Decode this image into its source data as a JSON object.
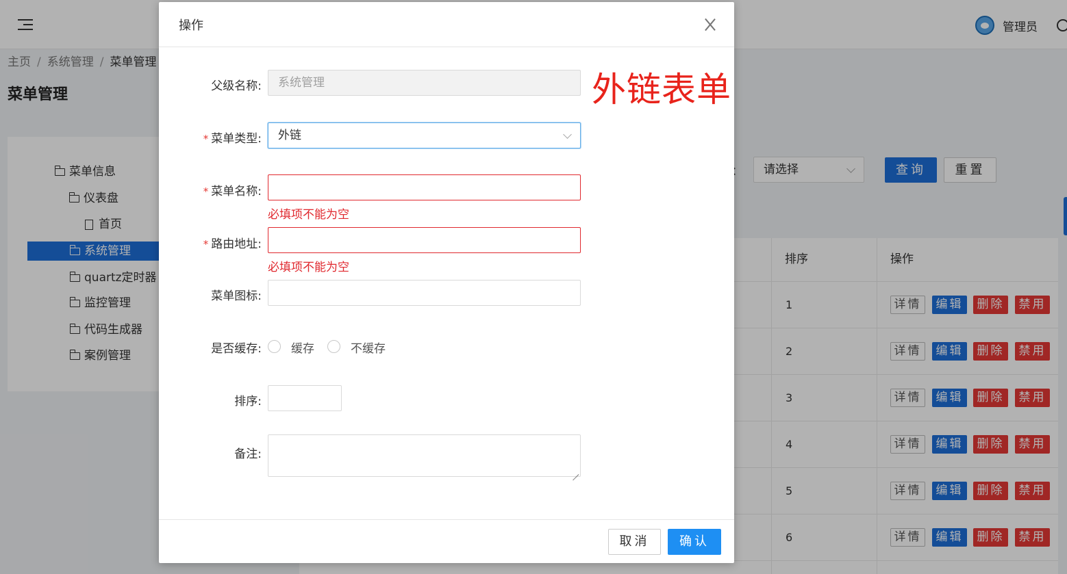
{
  "header": {
    "user_name": "管理员"
  },
  "breadcrumb": {
    "items": [
      "主页",
      "系统管理",
      "菜单管理"
    ]
  },
  "page": {
    "title": "菜单管理"
  },
  "tree": {
    "items": [
      {
        "label": "菜单信息"
      },
      {
        "label": "仪表盘"
      },
      {
        "label": "首页"
      },
      {
        "label": "系统管理"
      },
      {
        "label": "quartz定时器"
      },
      {
        "label": "监控管理"
      },
      {
        "label": "代码生成器"
      },
      {
        "label": "案例管理"
      }
    ]
  },
  "filter": {
    "label_suffix": "：",
    "select_value": "请选择",
    "query_button": "查询",
    "reset_button": "重置"
  },
  "table": {
    "columns": [
      "排序",
      "操作"
    ],
    "rows": [
      {
        "sort": "1"
      },
      {
        "sort": "2"
      },
      {
        "sort": "3"
      },
      {
        "sort": "4"
      },
      {
        "sort": "5"
      },
      {
        "sort": "6"
      }
    ],
    "actions": {
      "detail": "详情",
      "edit": "编辑",
      "delete": "删除",
      "disable": "禁用"
    }
  },
  "modal": {
    "title": "操作",
    "annotation": "外链表单",
    "fields": {
      "parent_name": {
        "label": "父级名称:",
        "value": "系统管理"
      },
      "menu_type": {
        "label": "菜单类型:",
        "value": "外链"
      },
      "menu_name": {
        "label": "菜单名称:",
        "value": "",
        "error": "必填项不能为空"
      },
      "route": {
        "label": "路由地址:",
        "value": "",
        "error": "必填项不能为空"
      },
      "icon": {
        "label": "菜单图标:",
        "value": ""
      },
      "cache": {
        "label": "是否缓存:",
        "options": [
          "缓存",
          "不缓存"
        ]
      },
      "sort": {
        "label": "排序:",
        "value": ""
      },
      "remark": {
        "label": "备注:",
        "value": ""
      }
    },
    "cancel_button": "取消",
    "ok_button": "确认"
  },
  "colors": {
    "primary": "#1e6fd9",
    "danger": "#e53935",
    "error_text": "#e0282e",
    "annotation": "#e8231b"
  }
}
